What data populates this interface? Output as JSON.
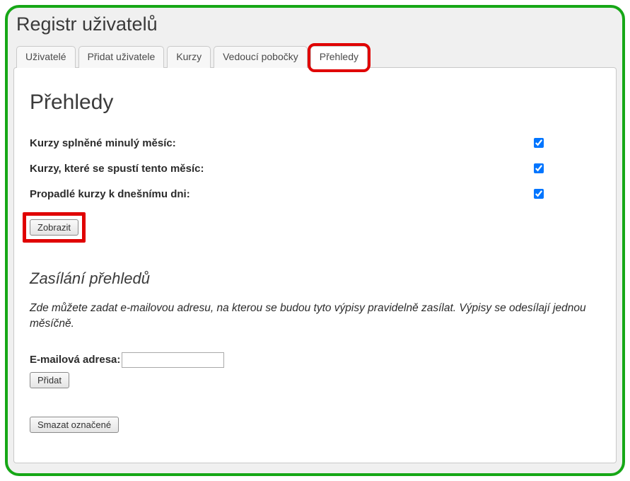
{
  "header": {
    "title": "Registr uživatelů"
  },
  "tabs": [
    {
      "label": "Uživatelé",
      "active": false
    },
    {
      "label": "Přidat uživatele",
      "active": false
    },
    {
      "label": "Kurzy",
      "active": false
    },
    {
      "label": "Vedoucí pobočky",
      "active": false
    },
    {
      "label": "Přehledy",
      "active": true
    }
  ],
  "panel": {
    "title": "Přehledy",
    "options": [
      {
        "label": "Kurzy splněné minulý měsíc:",
        "checked": true
      },
      {
        "label": "Kurzy, které se spustí tento měsíc:",
        "checked": true
      },
      {
        "label": "Propadlé kurzy k dnešnímu dni:",
        "checked": true
      }
    ],
    "show_button": "Zobrazit",
    "mailing": {
      "title": "Zasílání přehledů",
      "description": "Zde můžete zadat e-mailovou adresu, na kterou se budou tyto výpisy pravidelně zasílat. Výpisy se odesílají jednou měsíčně.",
      "email_label": "E-mailová adresa:",
      "email_value": "",
      "add_button": "Přidat",
      "delete_button": "Smazat označené"
    }
  }
}
